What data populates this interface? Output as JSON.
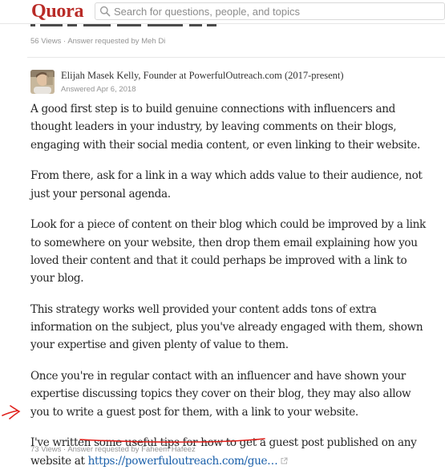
{
  "header": {
    "logo": "Quora",
    "search_placeholder": "Search for questions, people, and topics"
  },
  "previous_answer": {
    "views": "56 Views",
    "requested_by_prefix": "Answer requested by ",
    "requested_by_name": "Meh Di"
  },
  "answer": {
    "author_name": "Elijah Masek Kelly, Founder at PowerfulOutreach.com (2017-present)",
    "answered_date": "Answered Apr 6, 2018",
    "paragraphs": [
      "A good first step is to build genuine connections with influencers and thought leaders in your industry, by leaving comments on their blogs, engaging with their social media content, or even linking to their website.",
      "From there, ask for a link in a way which adds value to their audience, not just your personal agenda.",
      "Look for a piece of content on their blog which could be improved by a link to somewhere on your website, then drop them email explaining how you loved their content and that it could perhaps be improved with a link to your blog.",
      "This strategy works well provided your content adds tons of extra information on the subject, plus you've already engaged with them, shown your expertise and given plenty of value to them.",
      "Once you're in regular contact with an influencer and have shown your expertise discussing topics they cover on their blog, they may also allow you to write a guest post for them, with a link to your website."
    ],
    "last_paragraph_text": "I've written some useful tips for how to get a guest post published on any website at ",
    "last_paragraph_link": "https://powerfuloutreach.com/gue…",
    "views": "73 Views",
    "requested_by_prefix": "Answer requested by ",
    "requested_by_name": "Faheem Hafeez"
  },
  "colors": {
    "brand": "#b92b27",
    "link": "#195faa",
    "annotation": "#e0201b"
  },
  "icons": {
    "search": "search-icon",
    "external_link": "external-link-icon"
  }
}
